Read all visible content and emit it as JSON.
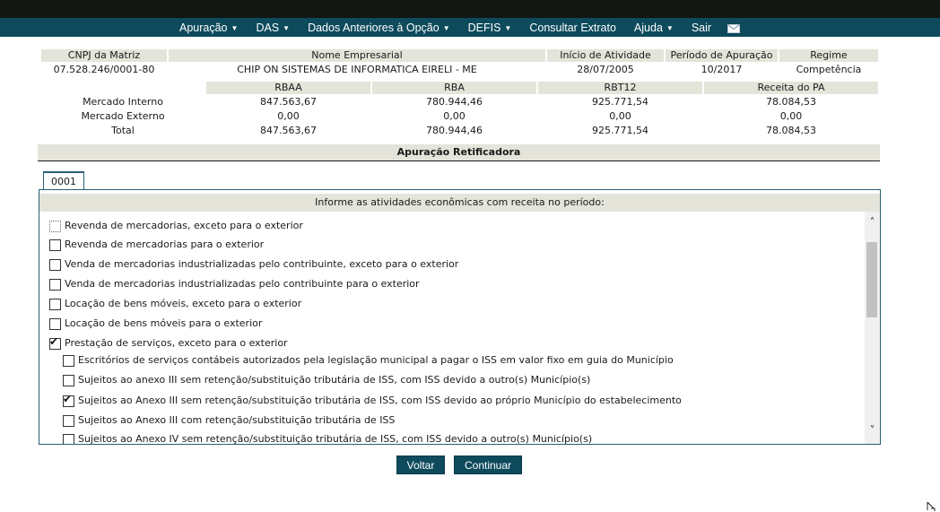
{
  "nav": {
    "items": [
      {
        "label": "Apuração",
        "caret": "▼"
      },
      {
        "label": "DAS",
        "caret": "▼"
      },
      {
        "label": "Dados Anteriores à Opção",
        "caret": "▼"
      },
      {
        "label": "DEFIS",
        "caret": "▼"
      },
      {
        "label": "Consultar Extrato",
        "caret": ""
      },
      {
        "label": "Ajuda",
        "caret": "▼"
      },
      {
        "label": "Sair",
        "caret": ""
      }
    ],
    "mail_icon": "envelope-icon"
  },
  "company": {
    "headers": {
      "cnpj": "CNPJ da Matriz",
      "nome": "Nome Empresarial",
      "inicio": "Início de Atividade",
      "periodo": "Período de Apuração",
      "regime": "Regime"
    },
    "values": {
      "cnpj": "07.528.246/0001-80",
      "nome": "CHIP ON SISTEMAS DE INFORMATICA EIRELI - ME",
      "inicio": "28/07/2005",
      "periodo": "10/2017",
      "regime": "Competência"
    }
  },
  "revenue": {
    "headers": [
      "RBAA",
      "RBA",
      "RBT12",
      "Receita do PA"
    ],
    "rows": [
      {
        "label": "Mercado Interno",
        "values": [
          "847.563,67",
          "780.944,46",
          "925.771,54",
          "78.084,53"
        ]
      },
      {
        "label": "Mercado Externo",
        "values": [
          "0,00",
          "0,00",
          "0,00",
          "0,00"
        ]
      },
      {
        "label": "Total",
        "values": [
          "847.563,67",
          "780.944,46",
          "925.771,54",
          "78.084,53"
        ]
      }
    ]
  },
  "section_title": "Apuração Retificadora",
  "tab_label": "0001",
  "panel_header": "Informe as atividades econômicas com receita no período:",
  "activities": [
    {
      "label": "Revenda de mercadorias, exceto para o exterior",
      "checked": false,
      "indent": 0,
      "focused": true
    },
    {
      "label": "Revenda de mercadorias para o exterior",
      "checked": false,
      "indent": 0
    },
    {
      "label": "Venda de mercadorias industrializadas pelo contribuinte, exceto para o exterior",
      "checked": false,
      "indent": 0
    },
    {
      "label": "Venda de mercadorias industrializadas pelo contribuinte para o exterior",
      "checked": false,
      "indent": 0
    },
    {
      "label": "Locação de bens móveis, exceto para o exterior",
      "checked": false,
      "indent": 0
    },
    {
      "label": "Locação de bens móveis para o exterior",
      "checked": false,
      "indent": 0
    },
    {
      "label": "Prestação de serviços, exceto para o exterior",
      "checked": true,
      "indent": 0
    },
    {
      "label": "Escritórios de serviços contábeis autorizados pela legislação municipal a pagar o ISS em valor fixo em guia do Município",
      "checked": false,
      "indent": 1
    },
    {
      "label": "Sujeitos ao anexo III sem retenção/substituição tributária de ISS, com ISS devido a outro(s) Município(s)",
      "checked": false,
      "indent": 1
    },
    {
      "label": "Sujeitos ao Anexo III sem retenção/substituição tributária de ISS, com ISS devido ao próprio Município do estabelecimento",
      "checked": true,
      "indent": 1
    },
    {
      "label": "Sujeitos ao Anexo III com retenção/substituição tributária de ISS",
      "checked": false,
      "indent": 1
    },
    {
      "label": "Sujeitos ao Anexo IV sem retenção/substituição tributária de ISS, com ISS devido a outro(s) Município(s)",
      "checked": false,
      "indent": 1
    }
  ],
  "buttons": {
    "back": "Voltar",
    "continue": "Continuar"
  }
}
